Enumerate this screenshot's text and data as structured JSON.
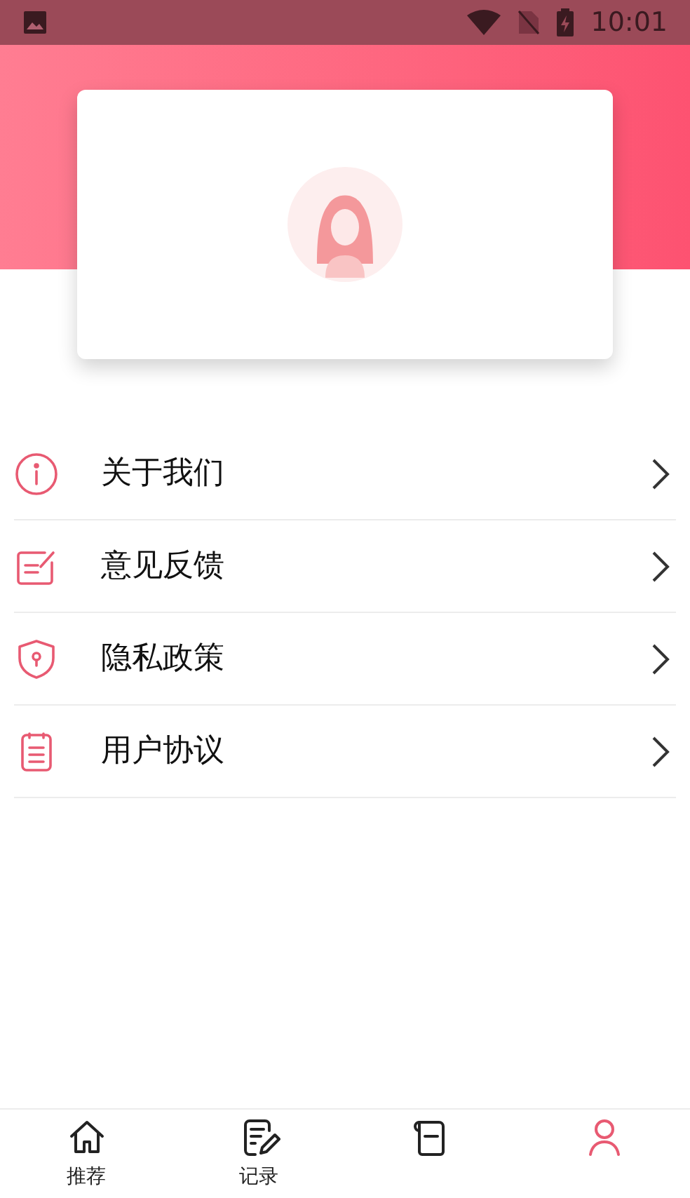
{
  "status_bar": {
    "time": "10:01"
  },
  "menu": [
    {
      "kind": "info",
      "label": "关于我们"
    },
    {
      "kind": "feedback",
      "label": "意见反馈"
    },
    {
      "kind": "privacy",
      "label": "隐私政策"
    },
    {
      "kind": "agreement",
      "label": "用户协议"
    }
  ],
  "bottom_nav": [
    {
      "kind": "home",
      "label": "推荐",
      "selected": false
    },
    {
      "kind": "record",
      "label": "记录",
      "selected": false
    },
    {
      "kind": "book",
      "selected": false
    },
    {
      "kind": "person",
      "selected": true
    }
  ]
}
